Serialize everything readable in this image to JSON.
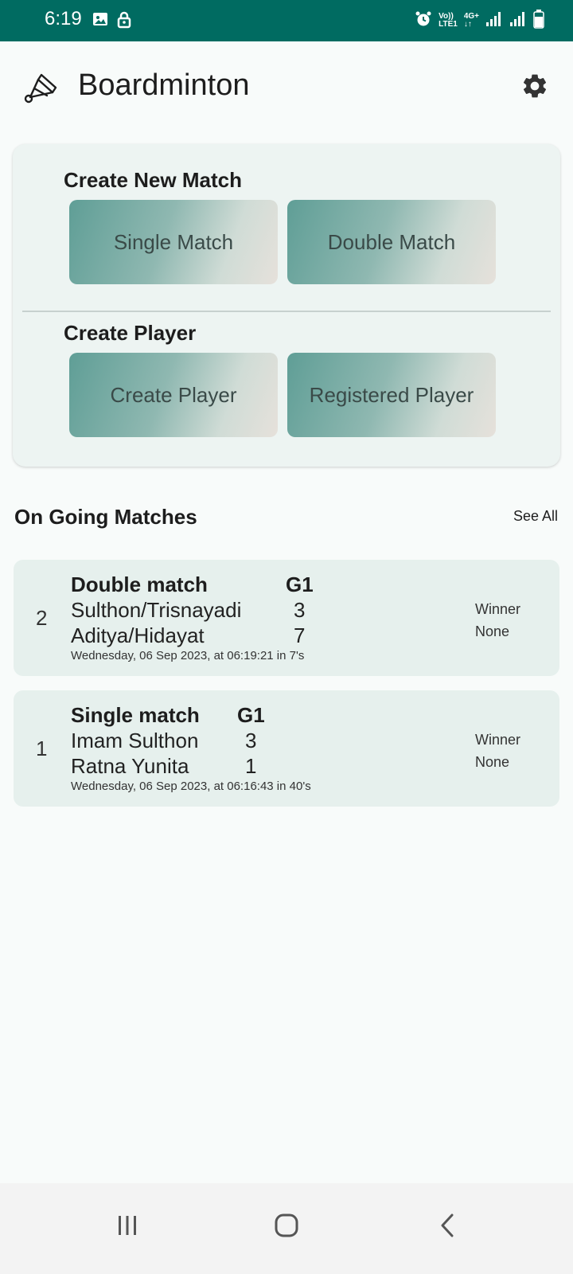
{
  "status_bar": {
    "time": "6:19",
    "network_top": "Vo))",
    "network_bottom": "LTE1",
    "data_type": "4G+"
  },
  "app_bar": {
    "title": "Boardminton",
    "logo_icon": "shuttlecock-icon",
    "settings_icon": "gear-icon"
  },
  "create_match": {
    "heading": "Create New Match",
    "single_label": "Single Match",
    "double_label": "Double Match"
  },
  "create_player": {
    "heading": "Create Player",
    "create_label": "Create Player",
    "registered_label": "Registered Player"
  },
  "ongoing": {
    "title": "On Going Matches",
    "see_all": "See All",
    "matches": [
      {
        "index": "2",
        "type": "Double match",
        "game": "G1",
        "player1": "Sulthon/Trisnayadi",
        "score1": "3",
        "player2": "Aditya/Hidayat",
        "score2": "7",
        "date": "Wednesday, 06 Sep 2023, at 06:19:21 in 7's",
        "winner_label": "Winner",
        "winner_value": "None"
      },
      {
        "index": "1",
        "type": "Single match",
        "game": "G1",
        "player1": "Imam Sulthon",
        "score1": "3",
        "player2": "Ratna Yunita",
        "score2": "1",
        "date": "Wednesday, 06 Sep 2023, at 06:16:43 in 40's",
        "winner_label": "Winner",
        "winner_value": "None"
      }
    ]
  },
  "nav_bar": {
    "recents_icon": "recents-icon",
    "home_icon": "home-icon",
    "back_icon": "back-icon"
  },
  "colors": {
    "status_bar": "#006b61",
    "card_background": "#edf4f2",
    "match_card": "#e6f0ed"
  }
}
